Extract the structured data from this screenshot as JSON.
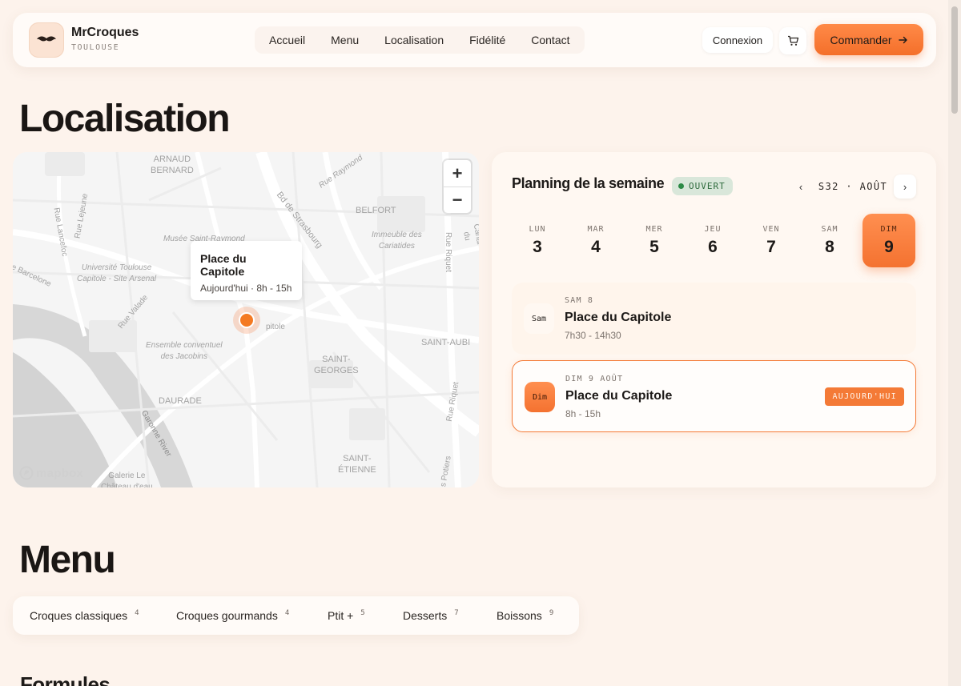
{
  "header": {
    "brand_name": "MrCroques",
    "brand_city": "TOULOUSE",
    "nav": [
      "Accueil",
      "Menu",
      "Localisation",
      "Fidélité",
      "Contact"
    ],
    "login_label": "Connexion",
    "order_label": "Commander"
  },
  "location": {
    "title": "Localisation",
    "map": {
      "popup_title": "Place du Capitole",
      "popup_subtitle": "Aujourd'hui · 8h - 15h",
      "zoom_in": "+",
      "zoom_out": "−",
      "attribution": "mapbox",
      "labels": {
        "arnaud": "ARNAUD\nBERNARD",
        "raymond": "Rue Raymond",
        "strasbourg": "Bd de Strasbourg",
        "belfort": "BELFORT",
        "lejeune": "Rue Lejeune",
        "lancefoc": "Rue Lancefoc",
        "musee": "Musée Saint-Raymond",
        "immeuble": "Immeuble des\nCariatides",
        "riquet": "Rue Riquet",
        "canal": "Canal du",
        "universite": "Université Toulouse\nCapitole - Site Arsenal",
        "barcelone": "e Barcelone",
        "valade": "Rue Valade",
        "capitole_fragment": "pitole",
        "jacobins": "Ensemble conventuel\ndes Jacobins",
        "saint_aubin": "SAINT-AUBI",
        "saint_georges": "SAINT-\nGEORGES",
        "daurade": "DAURADE",
        "garonne": "Garonne River",
        "riquet2": "Rue Riquet",
        "saint_etienne": "SAINT-\nÉTIENNE",
        "potiers": "s Potiers",
        "galerie": "Galerie Le\nChâteau d'eau"
      }
    },
    "planning": {
      "title": "Planning de la semaine",
      "status": "OUVERT",
      "week_label": "S32 · AOÛT",
      "prev": "‹",
      "next": "›",
      "days": [
        {
          "name": "LUN",
          "num": "3"
        },
        {
          "name": "MAR",
          "num": "4"
        },
        {
          "name": "MER",
          "num": "5"
        },
        {
          "name": "JEU",
          "num": "6"
        },
        {
          "name": "VEN",
          "num": "7"
        },
        {
          "name": "SAM",
          "num": "8"
        },
        {
          "name": "DIM",
          "num": "9"
        }
      ],
      "active_day": "DIM",
      "slots": [
        {
          "badge": "Sam",
          "date": "SAM 8",
          "place": "Place du Capitole",
          "hours": "7h30 - 14h30"
        },
        {
          "badge": "Dim",
          "date": "DIM 9 AOÛT",
          "place": "Place du Capitole",
          "hours": "8h - 15h",
          "tag": "AUJOURD'HUI"
        }
      ]
    }
  },
  "menu": {
    "title": "Menu",
    "categories": [
      {
        "label": "Croques classiques",
        "count": "4"
      },
      {
        "label": "Croques gourmands",
        "count": "4"
      },
      {
        "label": "Ptit +",
        "count": "5"
      },
      {
        "label": "Desserts",
        "count": "7"
      },
      {
        "label": "Boissons",
        "count": "9"
      }
    ]
  },
  "formules": {
    "title": "Formules"
  },
  "colors": {
    "accent": "#f47a36",
    "background": "#fdf3ec",
    "open_green": "#2e8b47"
  },
  "icons": {
    "logo": "mustache-icon",
    "cart": "cart-icon",
    "order_arrow": "arrow-right-icon"
  }
}
